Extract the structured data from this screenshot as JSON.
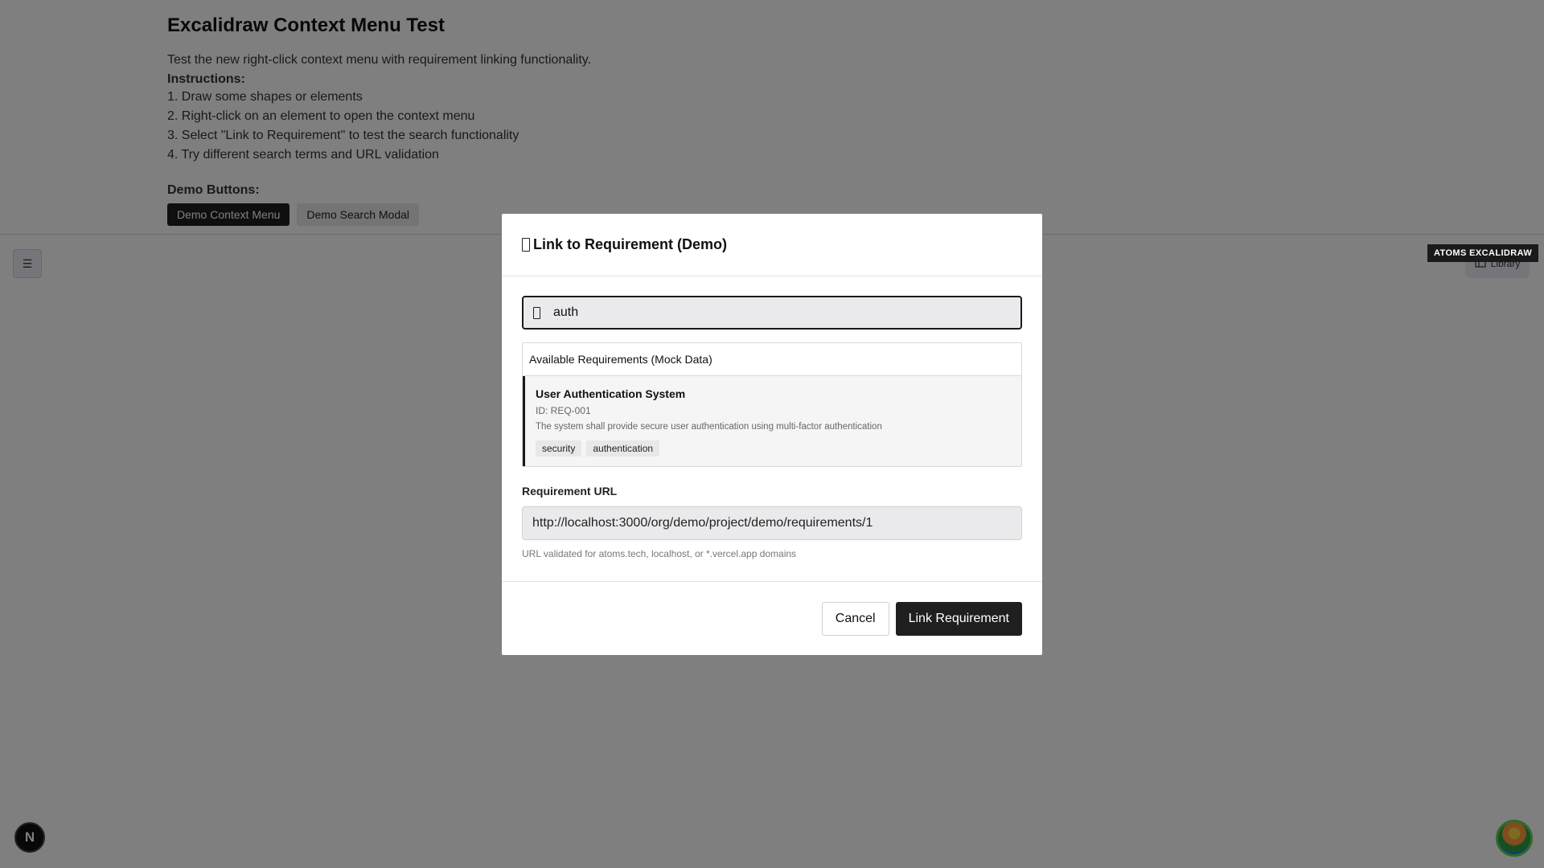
{
  "page": {
    "title": "Excalidraw Context Menu Test",
    "description": "Test the new right-click context menu with requirement linking functionality.",
    "instructions_label": "Instructions:",
    "instructions": [
      "1. Draw some shapes or elements",
      "2. Right-click on an element to open the context menu",
      "3. Select \"Link to Requirement\" to test the search functionality",
      "4. Try different search terms and URL validation"
    ],
    "demo_label": "Demo Buttons:",
    "demo_context_menu_label": "Demo Context Menu",
    "demo_search_modal_label": "Demo Search Modal"
  },
  "canvas": {
    "menu_icon": "hamburger-icon",
    "library_label": "Library",
    "brand_badge": "ATOMS EXCALIDRAW"
  },
  "next_badge": "N",
  "modal": {
    "title": "Link to Requirement (Demo)",
    "search": {
      "value": "auth",
      "icon": "search-icon"
    },
    "requirements_header": "Available Requirements (Mock Data)",
    "requirement": {
      "title": "User Authentication System",
      "id": "ID: REQ-001",
      "description": "The system shall provide secure user authentication using multi-factor authentication",
      "tags": [
        "security",
        "authentication"
      ]
    },
    "url_label": "Requirement URL",
    "url_value": "http://localhost:3000/org/demo/project/demo/requirements/1",
    "url_hint": "URL validated for atoms.tech, localhost, or *.vercel.app domains",
    "cancel_label": "Cancel",
    "link_label": "Link Requirement"
  }
}
